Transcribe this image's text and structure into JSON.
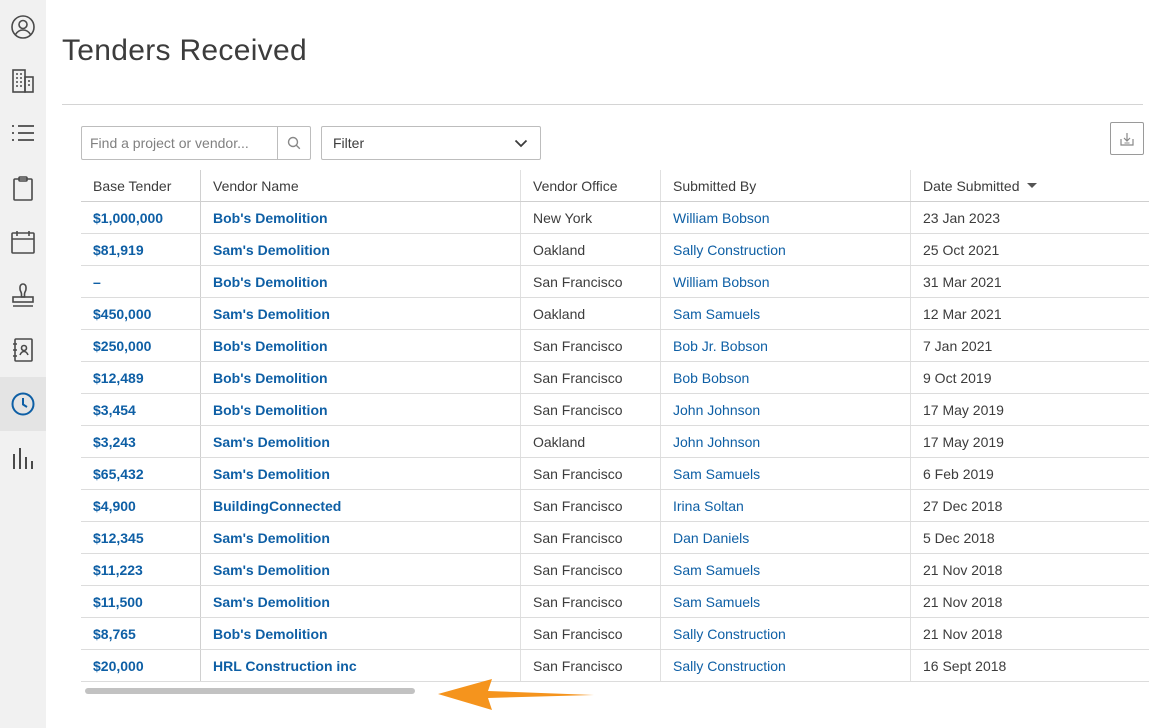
{
  "page": {
    "title": "Tenders Received"
  },
  "sidebar": {
    "items": [
      {
        "icon": "user-circle-icon"
      },
      {
        "icon": "building-icon"
      },
      {
        "icon": "list-icon"
      },
      {
        "icon": "clipboard-icon"
      },
      {
        "icon": "calendar-icon"
      },
      {
        "icon": "stamp-icon"
      },
      {
        "icon": "address-book-icon"
      },
      {
        "icon": "clock-icon",
        "active": true
      },
      {
        "icon": "bar-chart-icon"
      }
    ],
    "active_color": "#0e5fa5",
    "icon_color": "#4a4a4a"
  },
  "toolbar": {
    "search_placeholder": "Find a project or vendor...",
    "filter_label": "Filter"
  },
  "table": {
    "columns": [
      "Base Tender",
      "Vendor Name",
      "Vendor Office",
      "Submitted By",
      "Date Submitted"
    ],
    "sorted_column": "Date Submitted",
    "rows": [
      {
        "tender": "$1,000,000",
        "vendor": "Bob's Demolition",
        "office": "New York",
        "submitted_by": "William Bobson",
        "date": "23 Jan 2023"
      },
      {
        "tender": "$81,919",
        "vendor": "Sam's Demolition",
        "office": "Oakland",
        "submitted_by": "Sally Construction",
        "date": "25 Oct 2021"
      },
      {
        "tender": "–",
        "vendor": "Bob's Demolition",
        "office": "San Francisco",
        "submitted_by": "William Bobson",
        "date": "31 Mar 2021"
      },
      {
        "tender": "$450,000",
        "vendor": "Sam's Demolition",
        "office": "Oakland",
        "submitted_by": "Sam Samuels",
        "date": "12 Mar 2021"
      },
      {
        "tender": "$250,000",
        "vendor": "Bob's Demolition",
        "office": "San Francisco",
        "submitted_by": "Bob Jr. Bobson",
        "date": "7 Jan 2021"
      },
      {
        "tender": "$12,489",
        "vendor": "Bob's Demolition",
        "office": "San Francisco",
        "submitted_by": "Bob Bobson",
        "date": "9 Oct 2019"
      },
      {
        "tender": "$3,454",
        "vendor": "Bob's Demolition",
        "office": "San Francisco",
        "submitted_by": "John Johnson",
        "date": "17 May 2019"
      },
      {
        "tender": "$3,243",
        "vendor": "Sam's Demolition",
        "office": "Oakland",
        "submitted_by": "John Johnson",
        "date": "17 May 2019"
      },
      {
        "tender": "$65,432",
        "vendor": "Sam's Demolition",
        "office": "San Francisco",
        "submitted_by": "Sam Samuels",
        "date": "6 Feb 2019"
      },
      {
        "tender": "$4,900",
        "vendor": "BuildingConnected",
        "office": "San Francisco",
        "submitted_by": "Irina Soltan",
        "date": "27 Dec 2018"
      },
      {
        "tender": "$12,345",
        "vendor": "Sam's Demolition",
        "office": "San Francisco",
        "submitted_by": "Dan Daniels",
        "date": "5 Dec 2018"
      },
      {
        "tender": "$11,223",
        "vendor": "Sam's Demolition",
        "office": "San Francisco",
        "submitted_by": "Sam Samuels",
        "date": "21 Nov 2018"
      },
      {
        "tender": "$11,500",
        "vendor": "Sam's Demolition",
        "office": "San Francisco",
        "submitted_by": "Sam Samuels",
        "date": "21 Nov 2018"
      },
      {
        "tender": "$8,765",
        "vendor": "Bob's Demolition",
        "office": "San Francisco",
        "submitted_by": "Sally Construction",
        "date": "21 Nov 2018"
      },
      {
        "tender": "$20,000",
        "vendor": "HRL Construction inc",
        "office": "San Francisco",
        "submitted_by": "Sally Construction",
        "date": "16 Sept 2018"
      }
    ]
  },
  "annotation": {
    "icon": "orange-arrow-icon",
    "color": "#f5941d"
  }
}
